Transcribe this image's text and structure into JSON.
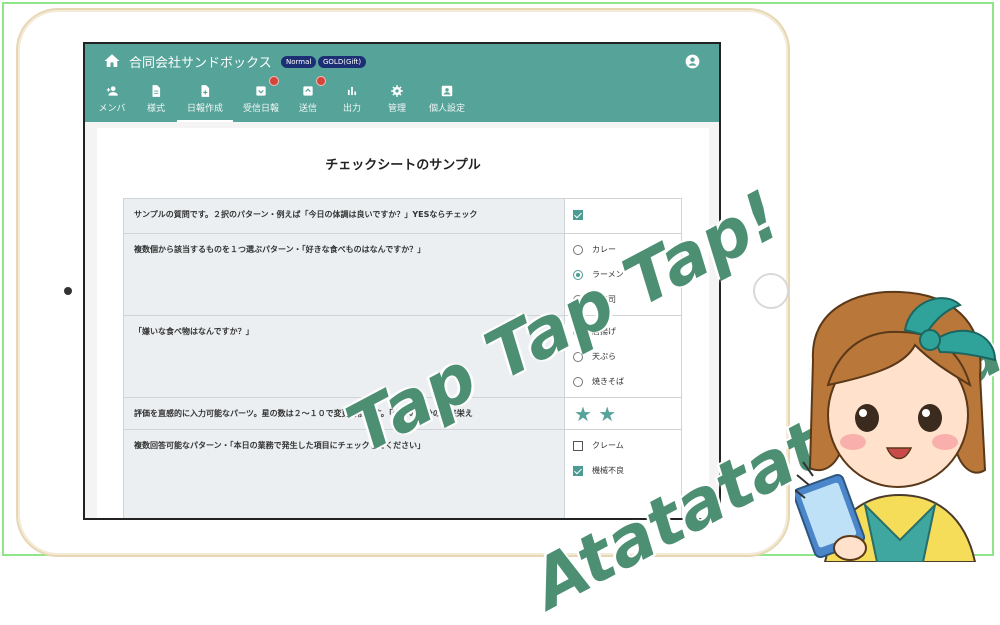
{
  "app": {
    "company": "合同会社サンドボックス",
    "badges": [
      "Normal",
      "GOLD(Gift)"
    ]
  },
  "nav": [
    {
      "label": "メンバ",
      "icon": "add-member-icon"
    },
    {
      "label": "様式",
      "icon": "document-icon"
    },
    {
      "label": "日報作成",
      "icon": "add-document-icon",
      "active": true
    },
    {
      "label": "受信日報",
      "icon": "inbox-icon",
      "notification": true
    },
    {
      "label": "送信",
      "icon": "outbox-icon",
      "notification": true
    },
    {
      "label": "出力",
      "icon": "bar-chart-icon"
    },
    {
      "label": "管理",
      "icon": "gear-icon"
    },
    {
      "label": "個人設定",
      "icon": "account-box-icon"
    }
  ],
  "sheet": {
    "title": "チェックシートのサンプル",
    "q1": {
      "text": "サンプルの質問です。２択のパターン・例えば「今日の体調は良いですか？」YESならチェック",
      "checked": true
    },
    "q2": {
      "text": "複数個から該当するものを１つ選ぶパターン・「好きな食べものはなんですか？」",
      "options": [
        "カレー",
        "ラーメン",
        "お寿司"
      ],
      "selected": 1
    },
    "q3": {
      "text": "「嫌いな食べ物はなんですか？」",
      "options": [
        "唐揚げ",
        "天ぷら",
        "焼きそば"
      ],
      "selected": 0
    },
    "q4": {
      "text": "評価を直感的に入力可能なパーツ。星の数は２〜１０で変更可能です。「今日の自分の出来栄え",
      "stars": "★ ★"
    },
    "q5": {
      "text": "複数回答可能なパターン・「本日の業務で発生した項目にチェックしてください」",
      "options": [
        "クレーム",
        "機械不良"
      ],
      "checked": [
        false,
        true
      ]
    }
  },
  "overlay": {
    "line1": "Tap Tap Tap!",
    "line2": "Atatatatatata"
  },
  "colors": {
    "appbar": "#55a399",
    "accent": "#4c9c93",
    "overlay_text": "#4d8f73"
  }
}
